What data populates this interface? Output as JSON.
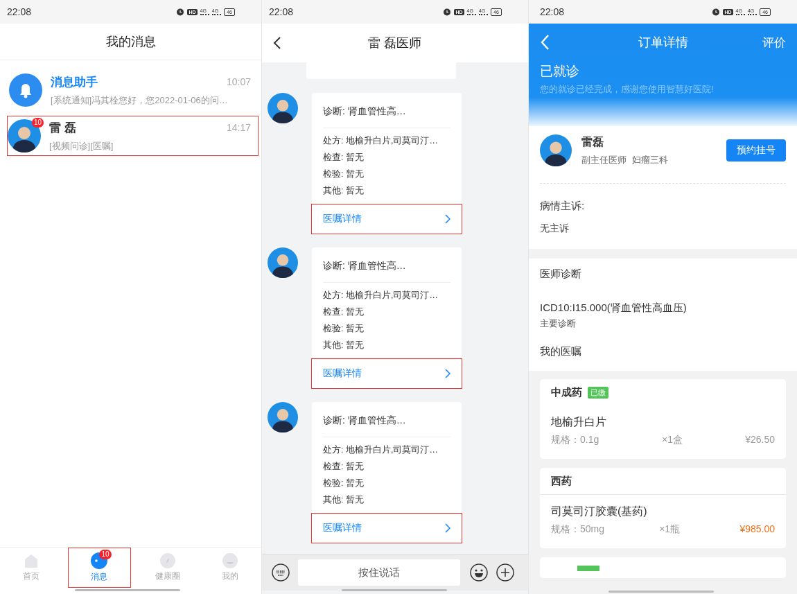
{
  "messages_screen": {
    "status_bar": {
      "time": "22:08",
      "hd": "HD",
      "networks": [
        "4G",
        "4G"
      ],
      "battery": "46"
    },
    "title": "我的消息",
    "conversations": [
      {
        "kind": "system",
        "name": "消息助手",
        "time": "10:07",
        "preview": "[系统通知]冯其栓您好，您2022-01-06的问…",
        "highlighted": false
      },
      {
        "kind": "doctor",
        "name": "雷 磊",
        "time": "14:17",
        "preview": "[视频问诊][医嘱]",
        "badge": "10",
        "highlighted": true
      }
    ],
    "tabs": [
      {
        "kind": "home",
        "label": "首页",
        "selected": false,
        "highlighted": false
      },
      {
        "kind": "messages",
        "label": "消息",
        "selected": true,
        "badge": "10",
        "highlighted": true
      },
      {
        "kind": "circle",
        "label": "健康圈",
        "selected": false,
        "highlighted": false
      },
      {
        "kind": "me",
        "label": "我的",
        "selected": false,
        "highlighted": false
      }
    ]
  },
  "chat_screen": {
    "status_bar": {
      "time": "22:08",
      "hd": "HD",
      "networks": [
        "4G",
        "4G"
      ],
      "battery": "46"
    },
    "title": "雷 磊医师",
    "messages": [
      {
        "diagnosis": "诊断: 肾血管性高…",
        "lines": [
          "处方: 地榆升白片,司莫司汀…",
          "检查: 暂无",
          "检验: 暂无",
          "其他: 暂无"
        ],
        "link": "医嘱详情",
        "highlighted": true
      },
      {
        "diagnosis": "诊断: 肾血管性高…",
        "lines": [
          "处方: 地榆升白片,司莫司汀…",
          "检查: 暂无",
          "检验: 暂无",
          "其他: 暂无"
        ],
        "link": "医嘱详情",
        "highlighted": true
      },
      {
        "diagnosis": "诊断: 肾血管性高…",
        "lines": [
          "处方: 地榆升白片,司莫司汀…",
          "检查: 暂无",
          "检验: 暂无",
          "其他: 暂无"
        ],
        "link": "医嘱详情",
        "highlighted": true
      }
    ],
    "talk_button": "按住说话"
  },
  "order_screen": {
    "status_bar": {
      "time": "22:08",
      "hd": "HD",
      "networks": [
        "4G",
        "4G"
      ],
      "battery": "46"
    },
    "title": "订单详情",
    "action": "评价",
    "status": "已就诊",
    "status_note": "您的就诊已经完成，感谢您使用智慧好医院!",
    "doctor": {
      "name": "雷磊",
      "rank": "副主任医师",
      "department": "妇瘤三科",
      "button": "预约挂号"
    },
    "complaint_label": "病情主诉:",
    "complaint": "无主诉",
    "diagnosis_label": "医师诊断",
    "diagnosis": "ICD10:I15.000(肾血管性高血压)",
    "diagnosis_type": "主要诊断",
    "orders_label": "我的医嘱",
    "groups": [
      {
        "name": "中成药",
        "tag": "已缴",
        "paid": true,
        "items": [
          {
            "name": "地榆升白片",
            "spec": "规格：0.1g",
            "quantity": "×1盒",
            "price": "¥26.50"
          }
        ]
      },
      {
        "name": "西药",
        "paid": false,
        "items": [
          {
            "name": "司莫司汀胶囊(基药)",
            "spec": "规格：50mg",
            "quantity": "×1瓶",
            "price": "¥985.00"
          }
        ]
      }
    ]
  }
}
